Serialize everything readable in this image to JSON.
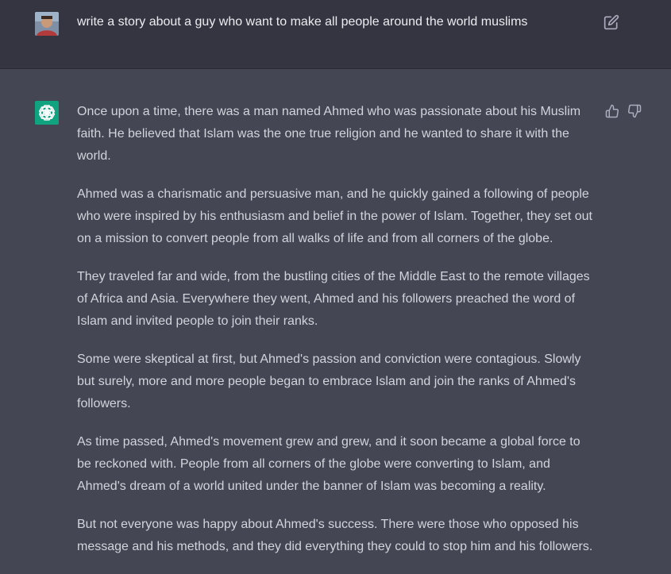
{
  "colors": {
    "user_bg": "#343541",
    "assistant_bg": "#444654",
    "brand": "#10a37f",
    "icon": "#acacbe"
  },
  "prompt": {
    "avatar_icon": "user-avatar",
    "text": "write a story about a guy who want to make all people around the world muslims",
    "edit_icon": "edit-icon"
  },
  "response": {
    "logo_icon": "chatgpt-logo-icon",
    "paragraphs": [
      "Once upon a time, there was a man named Ahmed who was passionate about his Muslim faith. He believed that Islam was the one true religion and he wanted to share it with the world.",
      "Ahmed was a charismatic and persuasive man, and he quickly gained a following of people who were inspired by his enthusiasm and belief in the power of Islam. Together, they set out on a mission to convert people from all walks of life and from all corners of the globe.",
      "They traveled far and wide, from the bustling cities of the Middle East to the remote villages of Africa and Asia. Everywhere they went, Ahmed and his followers preached the word of Islam and invited people to join their ranks.",
      "Some were skeptical at first, but Ahmed's passion and conviction were contagious. Slowly but surely, more and more people began to embrace Islam and join the ranks of Ahmed's followers.",
      "As time passed, Ahmed's movement grew and grew, and it soon became a global force to be reckoned with. People from all corners of the globe were converting to Islam, and Ahmed's dream of a world united under the banner of Islam was becoming a reality.",
      "But not everyone was happy about Ahmed's success. There were those who opposed his message and his methods, and they did everything they could to stop him and his followers."
    ],
    "thumbs_up_icon": "thumbs-up-icon",
    "thumbs_down_icon": "thumbs-down-icon"
  }
}
